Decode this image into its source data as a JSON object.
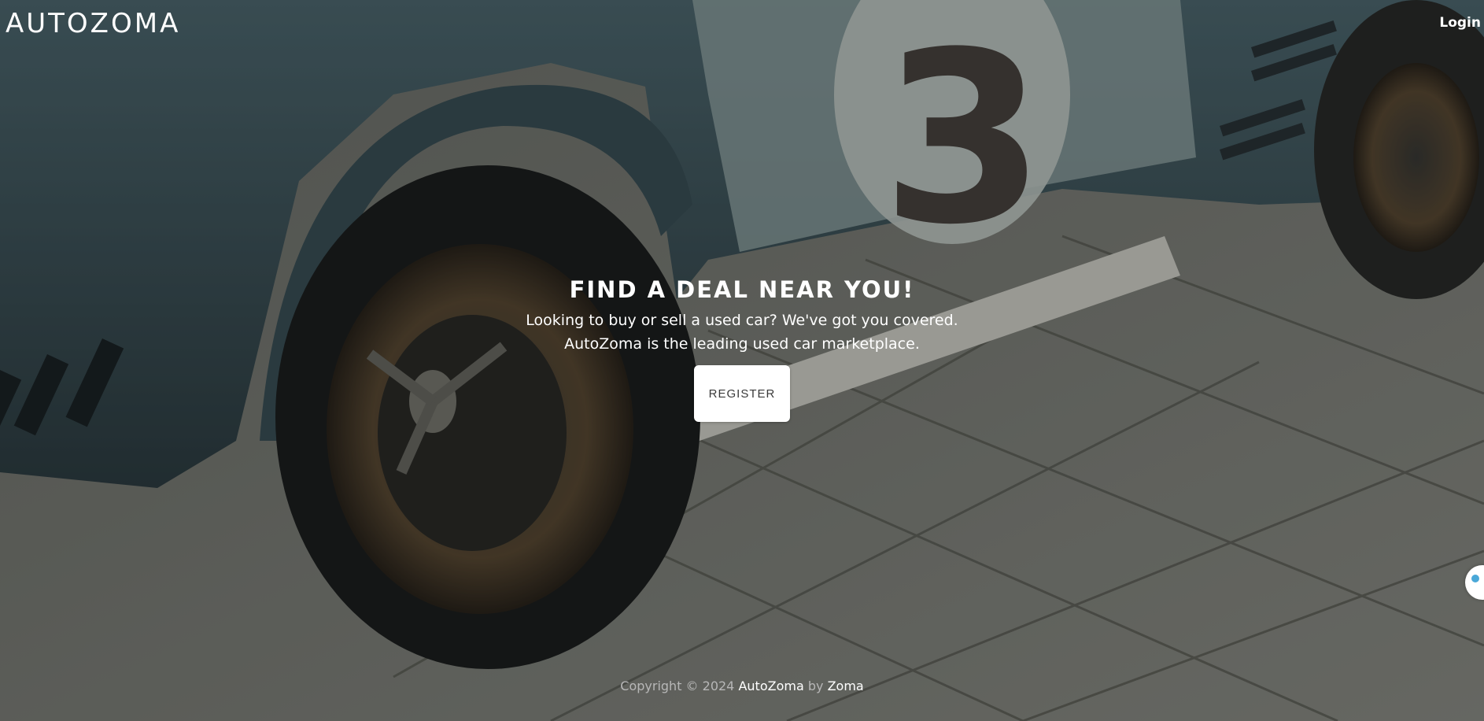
{
  "header": {
    "brand": "AUTOZOMA",
    "login_label": "Login"
  },
  "hero": {
    "title": "FIND A DEAL NEAR YOU!",
    "subtitle_line1": "Looking to buy or sell a used car? We've got you covered.",
    "subtitle_line2": "AutoZoma is the leading used car marketplace.",
    "register_label": "REGISTER"
  },
  "footer": {
    "prefix": "Copyright © 2024",
    "brand": "AutoZoma",
    "by": "by",
    "author": "Zoma"
  },
  "colors": {
    "overlay": "#000000",
    "text": "#ffffff",
    "button_bg": "#ffffff",
    "button_text": "#3a3a3a",
    "footer_text": "#b7b7b7"
  },
  "icons": {
    "side_widget": "chat-bubble-icon"
  }
}
